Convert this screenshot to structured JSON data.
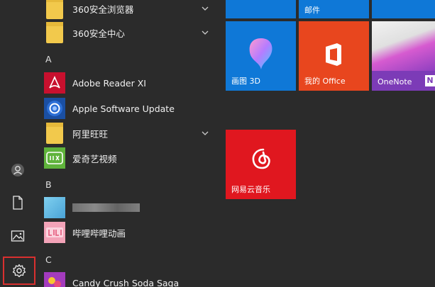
{
  "rail": {
    "icons": [
      "user-icon",
      "document-icon",
      "pictures-icon",
      "settings-icon"
    ]
  },
  "list": {
    "folder_360browser": "360安全浏览器",
    "folder_360center": "360安全中心",
    "section_a": "A",
    "adobe": "Adobe Reader XI",
    "apple_update": "Apple Software Update",
    "aliwangwang": "阿里旺旺",
    "iqiyi": "爱奇艺视频",
    "section_b": "B",
    "bilibili": "哔哩哔哩动画",
    "section_c": "C",
    "candy": "Candy Crush Soda Saga"
  },
  "tiles": {
    "mail": "邮件",
    "paint3d": "画图 3D",
    "office": "我的 Office",
    "onenote": "OneNote",
    "netease": "网易云音乐"
  },
  "colors": {
    "tile_blue": "#0f78d7",
    "tile_orange": "#e8461e",
    "tile_red": "#e0171f",
    "highlight": "#d9302f"
  }
}
